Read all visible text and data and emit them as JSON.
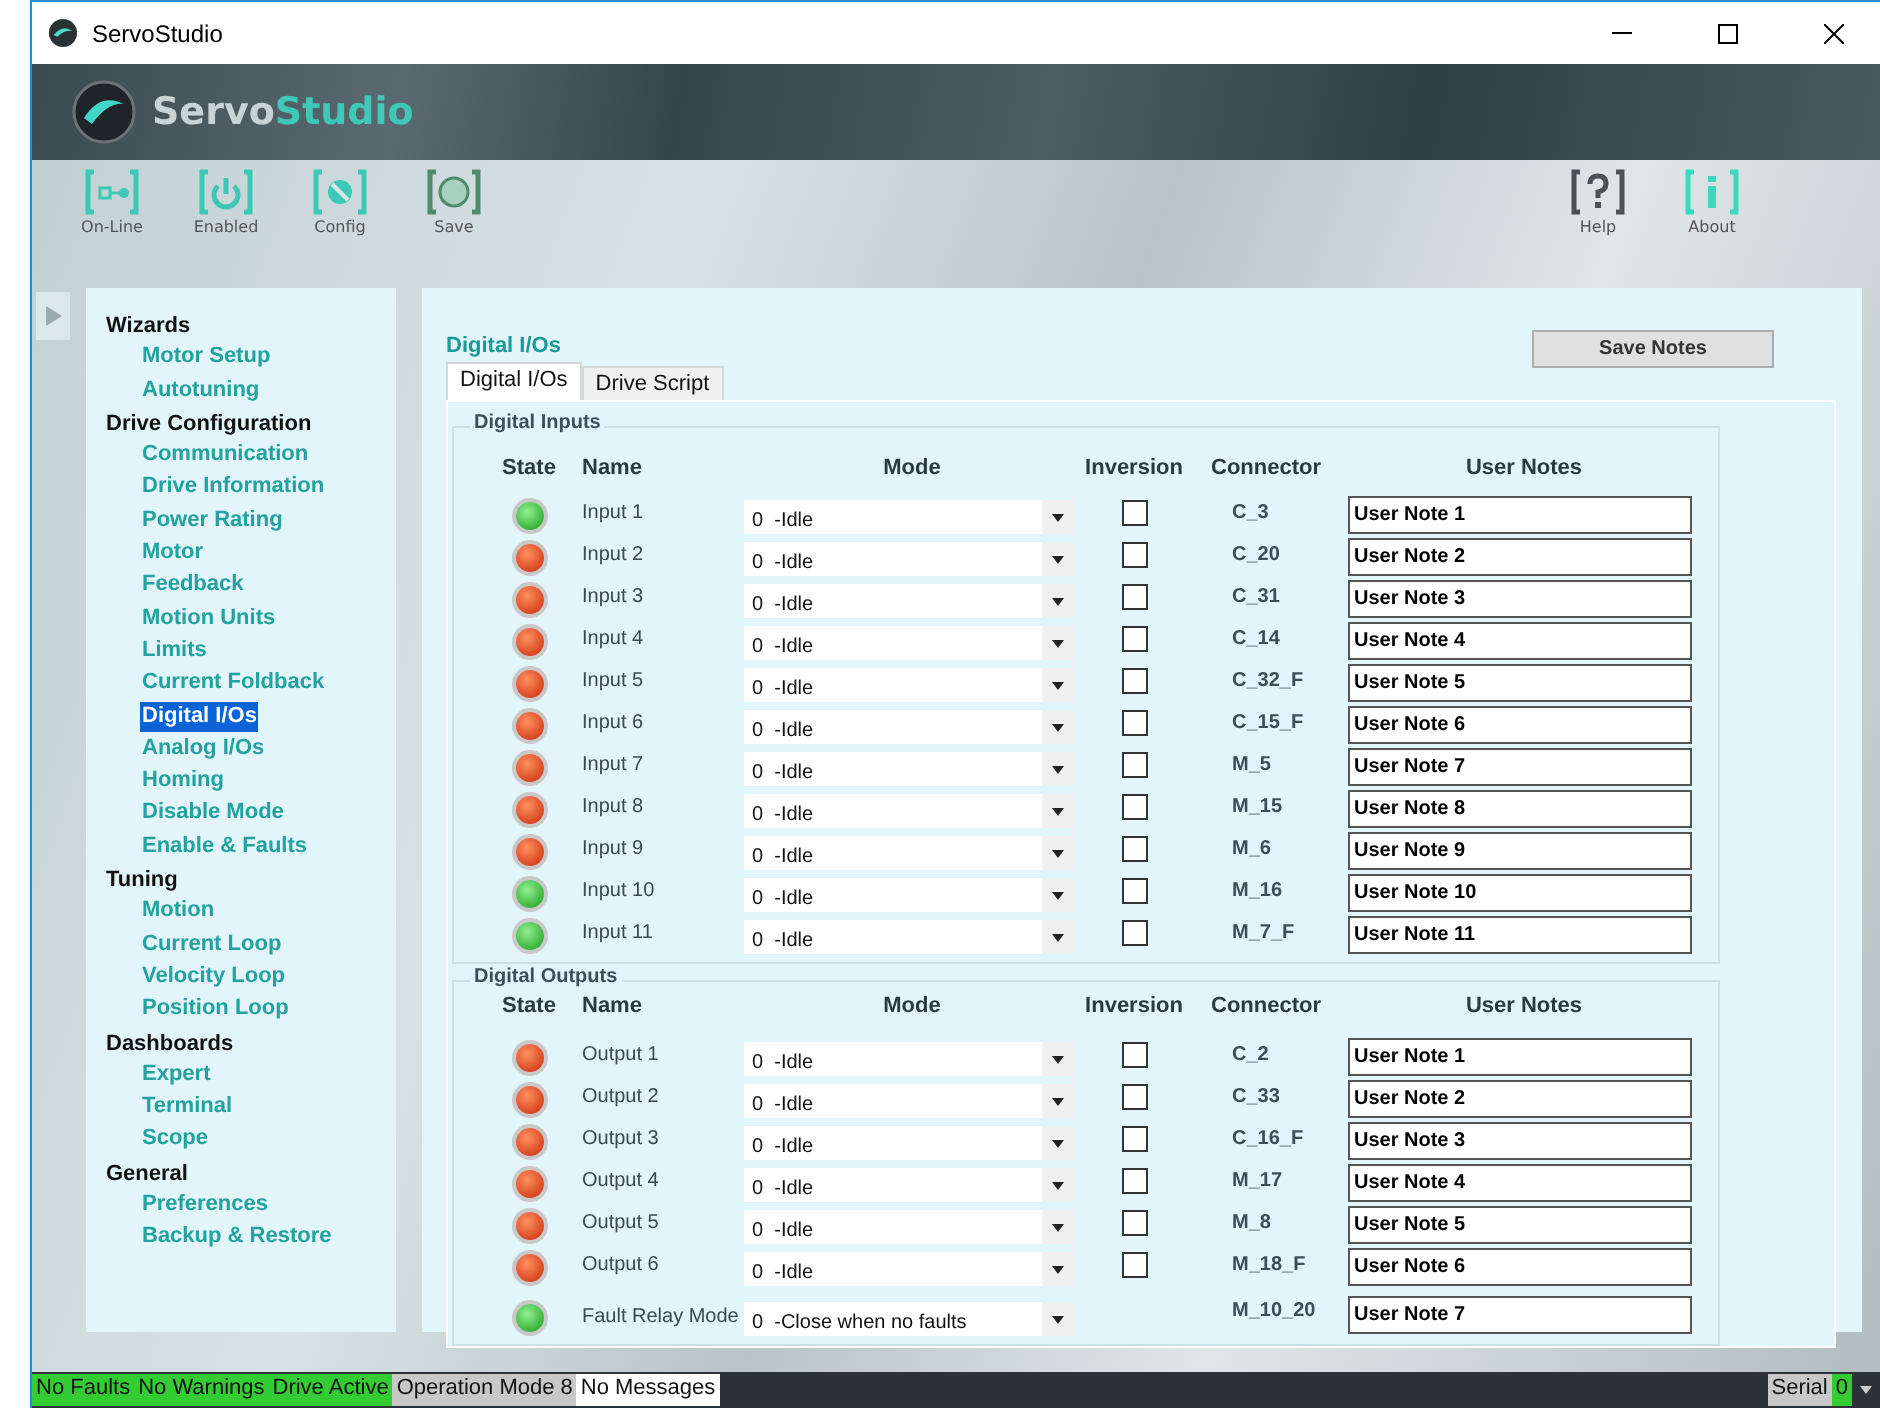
{
  "window": {
    "title": "ServoStudio"
  },
  "logo": {
    "part_1": "Servo",
    "part_2": "Studio"
  },
  "toolbar": [
    {
      "label": "On-Line",
      "color": "#3cc8b4"
    },
    {
      "label": "Enabled",
      "color": "#3cc8b4"
    },
    {
      "label": "Config",
      "color": "#3cc8b4"
    },
    {
      "label": "Save",
      "color": "#4f8a6a"
    },
    {
      "label": "Help",
      "color": "#4a5256"
    },
    {
      "label": "About",
      "color": "#3cd8c0"
    }
  ],
  "sidebar": [
    {
      "title": "Wizards",
      "children": [
        {
          "label": "Motor Setup",
          "selected": false
        },
        {
          "label": "Autotuning",
          "selected": false
        }
      ]
    },
    {
      "title": "Drive Configuration",
      "children": [
        {
          "label": "Communication",
          "selected": false
        },
        {
          "label": "Drive Information",
          "selected": false
        },
        {
          "label": "Power Rating",
          "selected": false
        },
        {
          "label": "Motor",
          "selected": false
        },
        {
          "label": "Feedback",
          "selected": false
        },
        {
          "label": "Motion Units",
          "selected": false
        },
        {
          "label": "Limits",
          "selected": false
        },
        {
          "label": "Current Foldback",
          "selected": false
        },
        {
          "label": "Digital I/Os",
          "selected": true
        },
        {
          "label": "Analog I/Os",
          "selected": false
        },
        {
          "label": "Homing",
          "selected": false
        },
        {
          "label": "Disable Mode",
          "selected": false
        },
        {
          "label": "Enable & Faults",
          "selected": false
        }
      ]
    },
    {
      "title": "Tuning",
      "children": [
        {
          "label": "Motion",
          "selected": false
        },
        {
          "label": "Current Loop",
          "selected": false
        },
        {
          "label": "Velocity Loop",
          "selected": false
        },
        {
          "label": "Position Loop",
          "selected": false
        }
      ]
    },
    {
      "title": "Dashboards",
      "children": [
        {
          "label": "Expert",
          "selected": false
        },
        {
          "label": "Terminal",
          "selected": false
        },
        {
          "label": "Scope",
          "selected": false
        }
      ]
    },
    {
      "title": "General",
      "children": [
        {
          "label": "Preferences",
          "selected": false
        },
        {
          "label": "Backup & Restore",
          "selected": false
        }
      ]
    }
  ],
  "page_title": "Digital I/Os",
  "save_button": "Save Notes",
  "tabs": [
    {
      "label": "Digital I/Os",
      "selected": true
    },
    {
      "label": "Drive Script",
      "selected": false
    }
  ],
  "groups": [
    {
      "title": "Digital Inputs",
      "columns": [
        "State",
        "Name",
        "Mode",
        "Inversion",
        "Connector",
        "User Notes"
      ],
      "rows": [
        {
          "kind": "io",
          "on": true,
          "name": "Input 1",
          "mode": "0  -Idle",
          "inverted": false,
          "connector": "C_3",
          "note": "User Note 1"
        },
        {
          "kind": "io",
          "on": false,
          "name": "Input 2",
          "mode": "0  -Idle",
          "inverted": false,
          "connector": "C_20",
          "note": "User Note 2"
        },
        {
          "kind": "io",
          "on": false,
          "name": "Input 3",
          "mode": "0  -Idle",
          "inverted": false,
          "connector": "C_31",
          "note": "User Note 3"
        },
        {
          "kind": "io",
          "on": false,
          "name": "Input 4",
          "mode": "0  -Idle",
          "inverted": false,
          "connector": "C_14",
          "note": "User Note 4"
        },
        {
          "kind": "io",
          "on": false,
          "name": "Input 5",
          "mode": "0  -Idle",
          "inverted": false,
          "connector": "C_32_F",
          "note": "User Note 5"
        },
        {
          "kind": "io",
          "on": false,
          "name": "Input 6",
          "mode": "0  -Idle",
          "inverted": false,
          "connector": "C_15_F",
          "note": "User Note 6"
        },
        {
          "kind": "io",
          "on": false,
          "name": "Input 7",
          "mode": "0  -Idle",
          "inverted": false,
          "connector": "M_5",
          "note": "User Note 7"
        },
        {
          "kind": "io",
          "on": false,
          "name": "Input 8",
          "mode": "0  -Idle",
          "inverted": false,
          "connector": "M_15",
          "note": "User Note 8"
        },
        {
          "kind": "io",
          "on": false,
          "name": "Input 9",
          "mode": "0  -Idle",
          "inverted": false,
          "connector": "M_6",
          "note": "User Note 9"
        },
        {
          "kind": "io",
          "on": true,
          "name": "Input 10",
          "mode": "0  -Idle",
          "inverted": false,
          "connector": "M_16",
          "note": "User Note 10"
        },
        {
          "kind": "io",
          "on": true,
          "name": "Input 11",
          "mode": "0  -Idle",
          "inverted": false,
          "connector": "M_7_F",
          "note": "User Note 11"
        }
      ]
    },
    {
      "title": "Digital Outputs",
      "columns": [
        "State",
        "Name",
        "Mode",
        "Inversion",
        "Connector",
        "User Notes"
      ],
      "rows": [
        {
          "kind": "io",
          "on": false,
          "name": "Output 1",
          "mode": "0  -Idle",
          "inverted": false,
          "connector": "C_2",
          "note": "User Note 1"
        },
        {
          "kind": "io",
          "on": false,
          "name": "Output 2",
          "mode": "0  -Idle",
          "inverted": false,
          "connector": "C_33",
          "note": "User Note 2"
        },
        {
          "kind": "io",
          "on": false,
          "name": "Output 3",
          "mode": "0  -Idle",
          "inverted": false,
          "connector": "C_16_F",
          "note": "User Note 3"
        },
        {
          "kind": "io",
          "on": false,
          "name": "Output 4",
          "mode": "0  -Idle",
          "inverted": false,
          "connector": "M_17",
          "note": "User Note 4"
        },
        {
          "kind": "io",
          "on": false,
          "name": "Output 5",
          "mode": "0  -Idle",
          "inverted": false,
          "connector": "M_8",
          "note": "User Note 5"
        },
        {
          "kind": "io",
          "on": false,
          "name": "Output 6",
          "mode": "0  -Idle",
          "inverted": false,
          "connector": "M_18_F",
          "note": "User Note 6"
        },
        {
          "kind": "relay",
          "on": true,
          "name": "Fault Relay Mode",
          "mode": "0  -Close when no faults",
          "connector": "M_10_20",
          "note": "User Note 7"
        }
      ]
    }
  ],
  "status_bar": [
    {
      "label": "No Faults",
      "color": "#33cc33"
    },
    {
      "label": "No Warnings",
      "color": "#33cc33"
    },
    {
      "label": "Drive Active",
      "color": "#33cc33"
    },
    {
      "label": "Operation Mode 8",
      "color": "#c8c8c8"
    },
    {
      "label": "No Messages",
      "color": "#ffffff"
    }
  ],
  "connection": {
    "label": "Serial",
    "value": "0"
  }
}
